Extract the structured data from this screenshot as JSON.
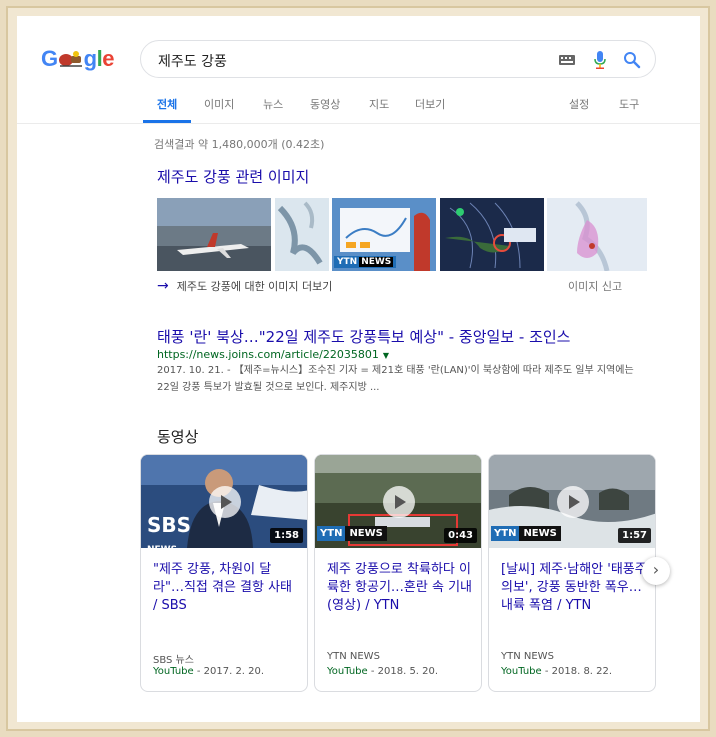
{
  "search": {
    "logo": "Google",
    "query": "제주도 강풍"
  },
  "tabs": [
    {
      "label": "전체",
      "active": true
    },
    {
      "label": "이미지"
    },
    {
      "label": "뉴스"
    },
    {
      "label": "동영상"
    },
    {
      "label": "지도"
    },
    {
      "label": "더보기"
    },
    {
      "label": "설정"
    },
    {
      "label": "도구"
    }
  ],
  "result_stats": "검색결과 약 1,480,000개 (0.42초)",
  "images": {
    "heading": "제주도 강풍 관련 이미지",
    "more_label": "제주도 강풍에 대한 이미지 더보기",
    "report_label": "이미지 신고",
    "thumb_news": {
      "ytn": "YTN",
      "news": "NEWS"
    }
  },
  "result": {
    "title": "태풍 '란' 북상…\"22일 제주도 강풍특보 예상\" - 중앙일보 - 조인스",
    "url": "https://news.joins.com/article/22035801",
    "snippet": "2017. 10. 21. - 【제주=뉴시스】조수진 기자 = 제21호 태풍 '란(LAN)'이 북상함에 따라 제주도 일부 지역에는 22일 강풍 특보가 발효될 것으로 보인다. 제주지방 ..."
  },
  "videos": {
    "heading": "동영상",
    "items": [
      {
        "title": "\"제주 강풍, 차원이 달라\"…직접 겪은 결항 사태 / SBS",
        "source": "SBS 뉴스",
        "site": "YouTube",
        "date": "2017. 2. 20.",
        "duration": "1:58",
        "badge": "SBS",
        "badge_sub": "NEWS"
      },
      {
        "title": "제주 강풍으로 착륙하다 이륙한 항공기…혼란 속 기내(영상) / YTN",
        "source": "YTN NEWS",
        "site": "YouTube",
        "date": "2018. 5. 20.",
        "duration": "0:43",
        "badge_y": "YTN",
        "badge_n": "NEWS"
      },
      {
        "title": "[날씨] 제주·남해안 '태풍주의보', 강풍 동반한 폭우…내륙 폭염 / YTN",
        "source": "YTN NEWS",
        "site": "YouTube",
        "date": "2018. 8. 22.",
        "duration": "1:57",
        "badge_y": "YTN",
        "badge_n": "NEWS"
      }
    ]
  },
  "colors": {
    "link": "#1a0dab",
    "url": "#006621",
    "accent": "#1a73e8"
  },
  "icons": [
    "keyboard-icon",
    "microphone-icon",
    "search-icon",
    "arrow-right-icon",
    "caret-down-icon",
    "play-icon",
    "chevron-right-icon"
  ]
}
